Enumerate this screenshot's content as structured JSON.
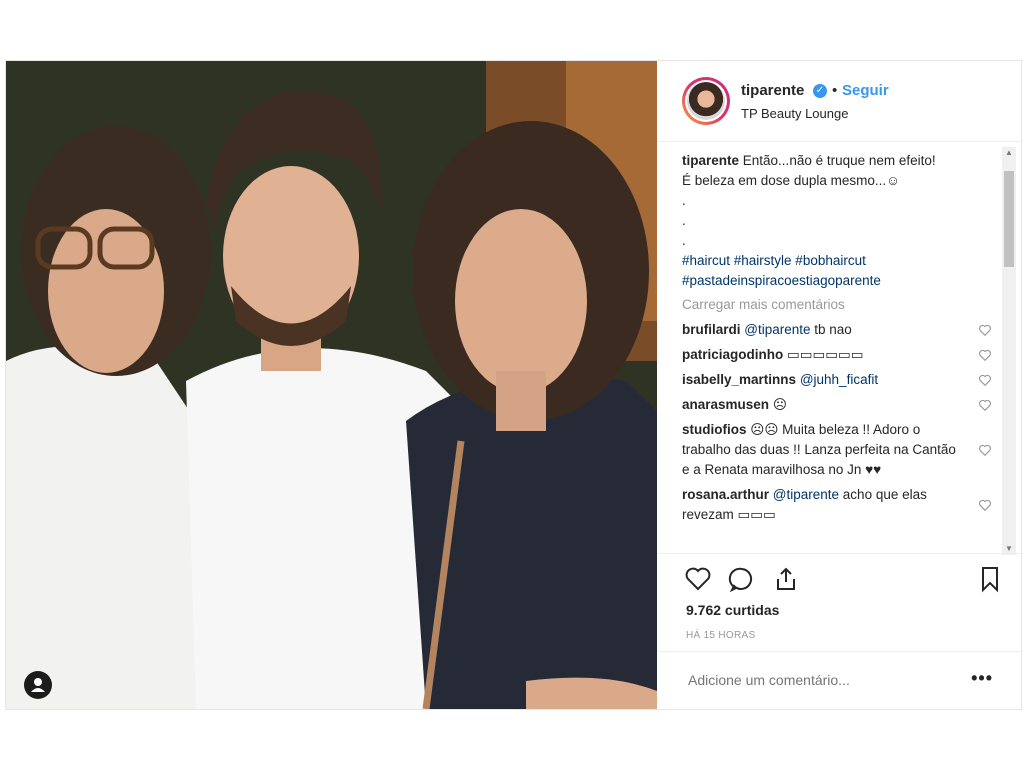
{
  "post": {
    "username": "tiparente",
    "follow_label": "Seguir",
    "separator": "•",
    "location": "TP Beauty Lounge",
    "verified_icon": "check",
    "caption": {
      "user": "tiparente",
      "line1": "Então...não é truque nem efeito!",
      "line2": "É beleza em dose dupla mesmo...☺",
      "dots": [
        ".",
        ".",
        "."
      ],
      "hashtags_line1": "#haircut #hairstyle #bobhaircut",
      "hashtags_line2": "#pastadeinspiracoestiagoparente"
    },
    "load_more": "Carregar mais comentários",
    "comments": [
      {
        "user": "brufilardi",
        "mention": "@tiparente",
        "text": " tb nao"
      },
      {
        "user": "patriciagodinho",
        "mention": "",
        "text": " ▭▭▭▭▭▭"
      },
      {
        "user": "isabelly_martinns",
        "mention": "@juhh_ficafit",
        "text": ""
      },
      {
        "user": "anarasmusen",
        "mention": "",
        "text": " ☹"
      },
      {
        "user": "studiofios",
        "mention": "",
        "text": " ☹☹ Muita beleza !! Adoro o trabalho das duas !! Lanza perfeita na Cantão e a Renata maravilhosa no Jn ♥♥"
      },
      {
        "user": "rosana.arthur",
        "mention": "@tiparente",
        "text": " acho que elas revezam ▭▭▭"
      }
    ],
    "likes": "9.762 curtidas",
    "time": "HÁ 15 HORAS",
    "add_comment_placeholder": "Adicione um comentário...",
    "more_label": "•••",
    "scroll_up": "▲",
    "scroll_down": "▼"
  },
  "colors": {
    "link": "#3897f0",
    "hashtag": "#003569",
    "muted": "#999999"
  }
}
